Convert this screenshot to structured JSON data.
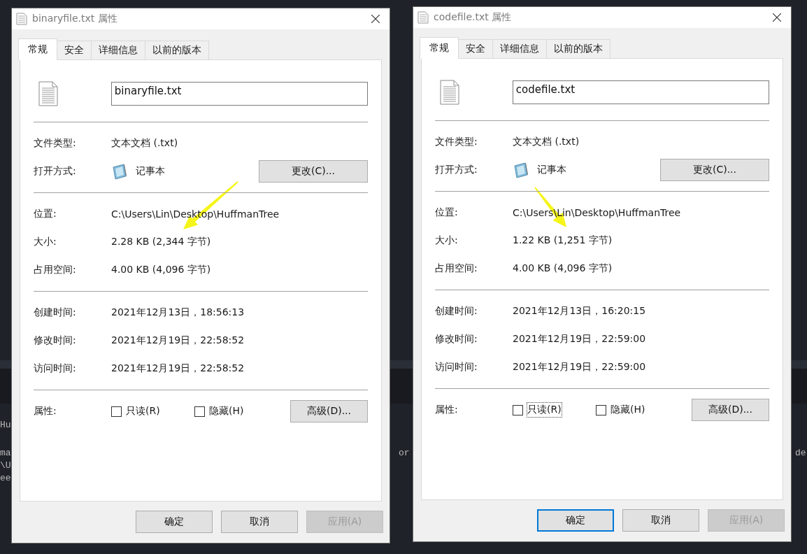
{
  "background_code": [
    {
      "text": "Hu"
    },
    {
      "text": "ma"
    },
    {
      "text": "\\U"
    },
    {
      "text": "ee"
    },
    {
      "text": "or"
    },
    {
      "text": "de"
    }
  ],
  "dialogs": [
    {
      "title": "binaryfile.txt 属性",
      "tabs": [
        {
          "label": "常规",
          "selected": true
        },
        {
          "label": "安全",
          "selected": false
        },
        {
          "label": "详细信息",
          "selected": false
        },
        {
          "label": "以前的版本",
          "selected": false
        }
      ],
      "file_name": "binaryfile.txt",
      "sections": [
        [
          {
            "label": "文件类型:",
            "value": "文本文档 (.txt)"
          },
          {
            "label": "打开方式:",
            "value": "记事本",
            "kind": "app",
            "button": "更改(C)..."
          }
        ],
        [
          {
            "label": "位置:",
            "value": "C:\\Users\\Lin\\Desktop\\HuffmanTree"
          },
          {
            "label": "大小:",
            "value": "2.28 KB (2,344 字节)"
          },
          {
            "label": "占用空间:",
            "value": "4.00 KB (4,096 字节)"
          }
        ],
        [
          {
            "label": "创建时间:",
            "value": "2021年12月13日，18:56:13"
          },
          {
            "label": "修改时间:",
            "value": "2021年12月19日，22:58:52"
          },
          {
            "label": "访问时间:",
            "value": "2021年12月19日，22:58:52"
          }
        ]
      ],
      "attributes": {
        "label": "属性:",
        "checkboxes": [
          {
            "label": "只读(R)",
            "checked": false,
            "focused": false
          },
          {
            "label": "隐藏(H)",
            "checked": false,
            "focused": false
          }
        ],
        "button": "高级(D)..."
      },
      "buttons": [
        {
          "label": "确定",
          "default": false,
          "disabled": false
        },
        {
          "label": "取消",
          "default": false,
          "disabled": false
        },
        {
          "label": "应用(A)",
          "default": false,
          "disabled": true
        }
      ]
    },
    {
      "title": "codefile.txt 属性",
      "tabs": [
        {
          "label": "常规",
          "selected": true
        },
        {
          "label": "安全",
          "selected": false
        },
        {
          "label": "详细信息",
          "selected": false
        },
        {
          "label": "以前的版本",
          "selected": false
        }
      ],
      "file_name": "codefile.txt",
      "sections": [
        [
          {
            "label": "文件类型:",
            "value": "文本文档 (.txt)"
          },
          {
            "label": "打开方式:",
            "value": "记事本",
            "kind": "app",
            "button": "更改(C)..."
          }
        ],
        [
          {
            "label": "位置:",
            "value": "C:\\Users\\Lin\\Desktop\\HuffmanTree"
          },
          {
            "label": "大小:",
            "value": "1.22 KB (1,251 字节)"
          },
          {
            "label": "占用空间:",
            "value": "4.00 KB (4,096 字节)"
          }
        ],
        [
          {
            "label": "创建时间:",
            "value": "2021年12月13日，16:20:15"
          },
          {
            "label": "修改时间:",
            "value": "2021年12月19日，22:59:00"
          },
          {
            "label": "访问时间:",
            "value": "2021年12月19日，22:59:00"
          }
        ]
      ],
      "attributes": {
        "label": "属性:",
        "checkboxes": [
          {
            "label": "只读(R)",
            "checked": false,
            "focused": true
          },
          {
            "label": "隐藏(H)",
            "checked": false,
            "focused": false
          }
        ],
        "button": "高级(D)..."
      },
      "buttons": [
        {
          "label": "确定",
          "default": true,
          "disabled": false
        },
        {
          "label": "取消",
          "default": false,
          "disabled": false
        },
        {
          "label": "应用(A)",
          "default": false,
          "disabled": true
        }
      ]
    }
  ]
}
